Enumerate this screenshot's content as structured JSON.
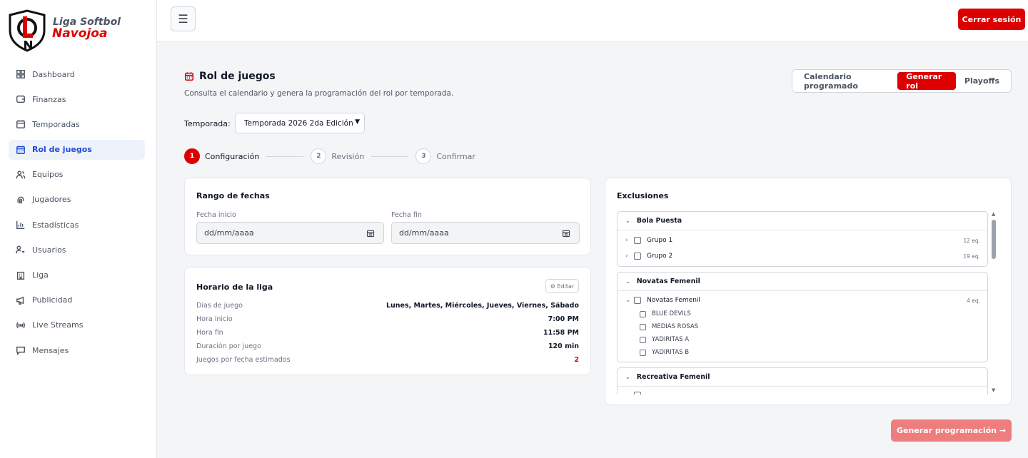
{
  "brand": {
    "line1": "Liga Softbol",
    "line2": "Navojoa"
  },
  "sidebar": {
    "items": [
      {
        "label": "Dashboard",
        "icon": "dashboard-icon"
      },
      {
        "label": "Finanzas",
        "icon": "wallet-icon"
      },
      {
        "label": "Temporadas",
        "icon": "calendar-icon"
      },
      {
        "label": "Rol de juegos",
        "icon": "calendar-days-icon",
        "active": true
      },
      {
        "label": "Equipos",
        "icon": "users-icon"
      },
      {
        "label": "Jugadores",
        "icon": "fingerprint-icon"
      },
      {
        "label": "Estadísticas",
        "icon": "bar-chart-icon"
      },
      {
        "label": "Usuarios",
        "icon": "user-key-icon"
      },
      {
        "label": "Liga",
        "icon": "building-icon"
      },
      {
        "label": "Publicidad",
        "icon": "megaphone-icon"
      },
      {
        "label": "Live Streams",
        "icon": "broadcast-icon"
      },
      {
        "label": "Mensajes",
        "icon": "message-icon"
      }
    ]
  },
  "topbar": {
    "menu_glyph": "☰",
    "logout_label": "Cerrar sesión"
  },
  "header": {
    "title": "Rol de juegos",
    "subtitle": "Consulta el calendario y genera la programación del rol por temporada."
  },
  "tabs": [
    {
      "label": "Calendario programado",
      "active": false
    },
    {
      "label": "Generar rol",
      "active": true
    },
    {
      "label": "Playoffs",
      "active": false
    }
  ],
  "season": {
    "label": "Temporada:",
    "value": "Temporada 2026 2da Edición"
  },
  "steps": [
    {
      "num": "1",
      "label": "Configuración",
      "active": true
    },
    {
      "num": "2",
      "label": "Revisión",
      "active": false
    },
    {
      "num": "3",
      "label": "Confirmar",
      "active": false
    }
  ],
  "date_range": {
    "title": "Rango de fechas",
    "start_label": "Fecha inicio",
    "start_placeholder": "dd/mm/aaaa",
    "end_label": "Fecha fin",
    "end_placeholder": "dd/mm/aaaa"
  },
  "schedule": {
    "title": "Horario de la liga",
    "edit_label": "⚙ Editar",
    "rows": [
      {
        "k": "Días de juego",
        "v": "Lunes, Martes, Miércoles, Jueves, Viernes, Sábado"
      },
      {
        "k": "Hora inicio",
        "v": "7:00 PM"
      },
      {
        "k": "Hora fin",
        "v": "11:58 PM"
      },
      {
        "k": "Duración por juego",
        "v": "120 min"
      },
      {
        "k": "Juegos por fecha estimados",
        "v": "2"
      }
    ]
  },
  "exclusions": {
    "title": "Exclusiones",
    "groups": [
      {
        "name": "Bola Puesta",
        "subs": [
          {
            "name": "Grupo 1",
            "count": "12 eq."
          },
          {
            "name": "Grupo 2",
            "count": "19 eq."
          }
        ]
      },
      {
        "name": "Novatas Femenil",
        "subs": [
          {
            "name": "Novatas Femenil",
            "count": "4 eq."
          }
        ],
        "teams": [
          "BLUE DEVILS",
          "MEDIAS ROSAS",
          "YADIRITAS A",
          "YADIRITAS B"
        ]
      },
      {
        "name": "Recreativa Femenil"
      }
    ]
  },
  "generate_label": "Generar programación →",
  "colors": {
    "accent": "#dc0000",
    "active_nav": "#1d4ed8"
  }
}
